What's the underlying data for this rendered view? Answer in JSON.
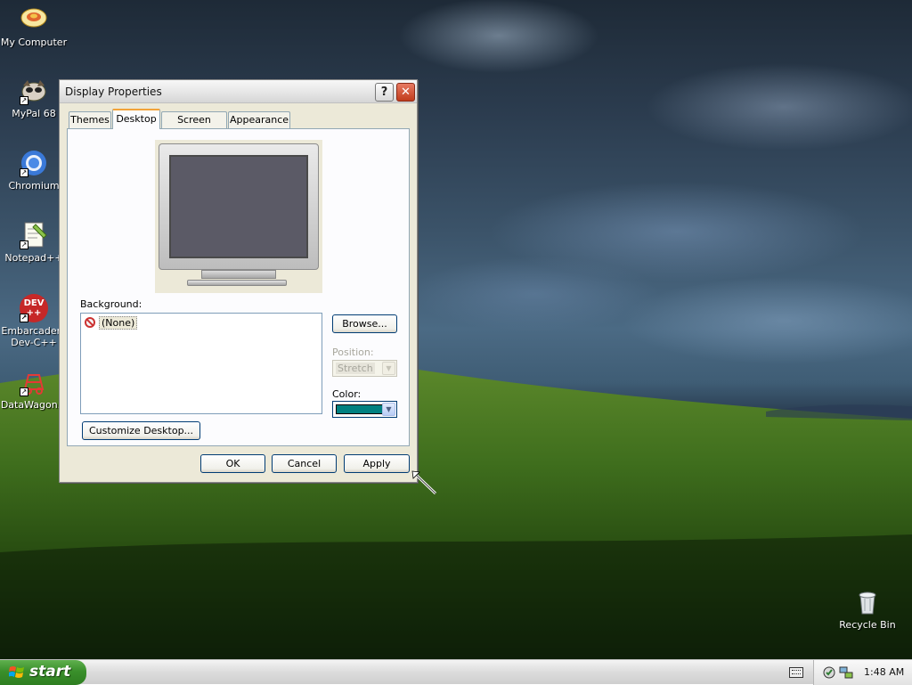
{
  "desktop": {
    "icons": [
      {
        "label": "My Computer",
        "icon": "my-computer-icon"
      },
      {
        "label": "MyPal 68",
        "icon": "mypal-icon"
      },
      {
        "label": "Chromium",
        "icon": "chromium-icon"
      },
      {
        "label": "Notepad++",
        "icon": "notepad-plus-plus-icon"
      },
      {
        "label": "Embarcadero Dev-C++",
        "line1": "Embarcadero",
        "line2": "Dev-C++",
        "icon": "devcpp-icon",
        "badge": "DEV",
        "badge2": "++"
      },
      {
        "label": "DataWagon...",
        "icon": "datawagon-icon"
      },
      {
        "label": "Recycle Bin",
        "icon": "recycle-bin-icon"
      }
    ]
  },
  "dialog": {
    "title": "Display Properties",
    "help_glyph": "?",
    "close_glyph": "✕",
    "tabs": [
      {
        "label": "Themes",
        "active": false
      },
      {
        "label": "Desktop",
        "active": true
      },
      {
        "label": "Screen Saver",
        "active": false
      },
      {
        "label": "Appearance",
        "active": false
      }
    ],
    "background_label": "Background:",
    "background_items": [
      {
        "label": "(None)",
        "selected": true
      }
    ],
    "browse_label": "Browse...",
    "position_label": "Position:",
    "position_value": "Stretch",
    "position_enabled": false,
    "color_label": "Color:",
    "color_value": "#008080",
    "customize_label": "Customize Desktop...",
    "ok_label": "OK",
    "cancel_label": "Cancel",
    "apply_label": "Apply",
    "preview_screen_color": "#5b5a66"
  },
  "taskbar": {
    "start_label": "start",
    "clock": "1:48 AM",
    "tray_icons": [
      "keyboard-icon",
      "security-shield-icon",
      "network-icon"
    ]
  },
  "colors": {
    "start_green": "#3a8f2b",
    "dialog_face": "#ece9d8",
    "tab_highlight": "#f2a33a"
  }
}
